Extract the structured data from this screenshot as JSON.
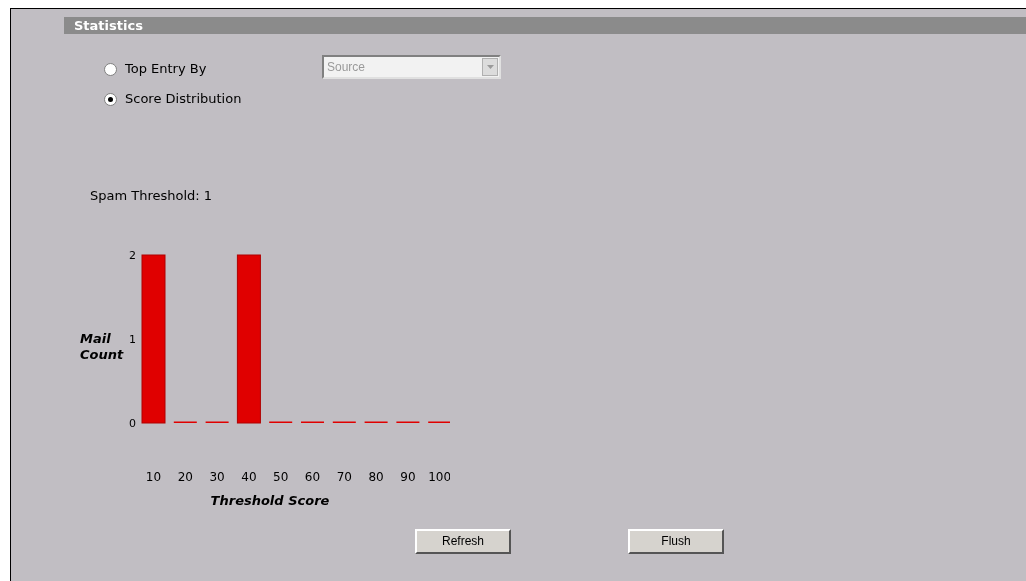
{
  "section_title": "Statistics",
  "options": [
    {
      "label": "Top Entry By",
      "selected": false
    },
    {
      "label": "Score Distribution",
      "selected": true
    }
  ],
  "entry_select": {
    "value": "Source",
    "disabled": true
  },
  "spam_threshold": "Spam Threshold: 1",
  "chart_data": {
    "type": "bar",
    "xlabel": "Threshold Score",
    "ylabel": "Mail Count",
    "categories": [
      "10",
      "20",
      "30",
      "40",
      "50",
      "60",
      "70",
      "80",
      "90",
      "100"
    ],
    "values": [
      2,
      0,
      0,
      2,
      0,
      0,
      0,
      0,
      0,
      0
    ],
    "ylim": [
      0,
      2
    ],
    "yticks": [
      0,
      1,
      2
    ]
  },
  "buttons": [
    "Refresh",
    "Flush"
  ]
}
